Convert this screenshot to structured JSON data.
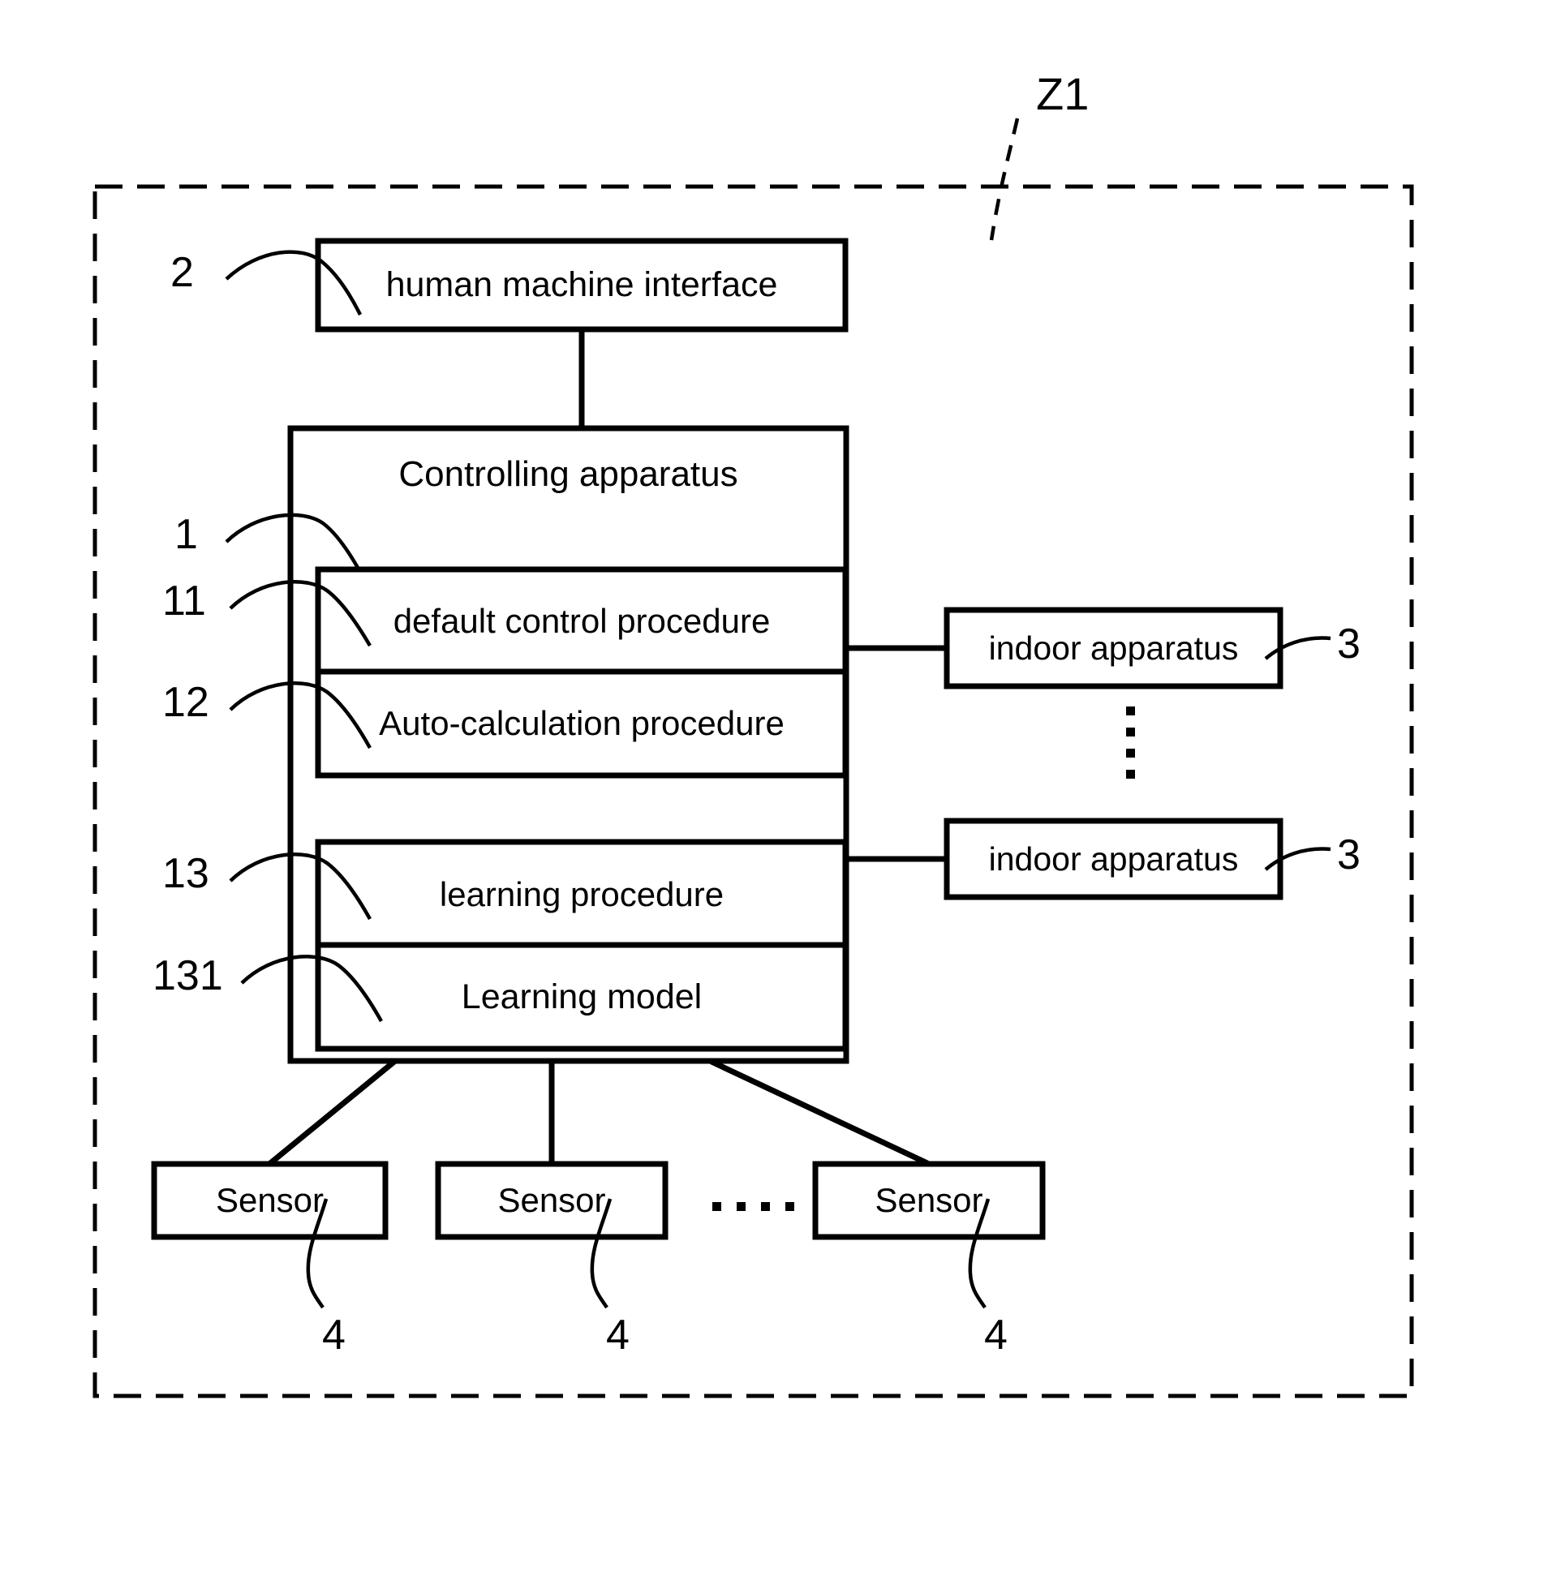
{
  "figure": {
    "system_label": "Z1",
    "boundary_style": "dash-dot enclosure"
  },
  "blocks": {
    "hmi": {
      "label": "human machine interface",
      "ref": "2"
    },
    "controller": {
      "label": "Controlling apparatus",
      "ref": "1"
    },
    "default_control": {
      "label": "default control procedure",
      "ref": "11"
    },
    "auto_calculation": {
      "label": "Auto-calculation procedure",
      "ref": "12"
    },
    "learning_procedure": {
      "label": "learning procedure",
      "ref": "13"
    },
    "learning_model": {
      "label": "Learning model",
      "ref": "131"
    }
  },
  "indoor_apparatus": [
    {
      "label": "indoor apparatus",
      "ref": "3"
    },
    {
      "label": "indoor apparatus",
      "ref": "3"
    }
  ],
  "sensors": [
    {
      "label": "Sensor",
      "ref": "4"
    },
    {
      "label": "Sensor",
      "ref": "4"
    },
    {
      "label": "Sensor",
      "ref": "4"
    }
  ],
  "ellipses": {
    "vertical_between_indoor": "⋮",
    "horizontal_between_sensors": "· · · ·"
  }
}
